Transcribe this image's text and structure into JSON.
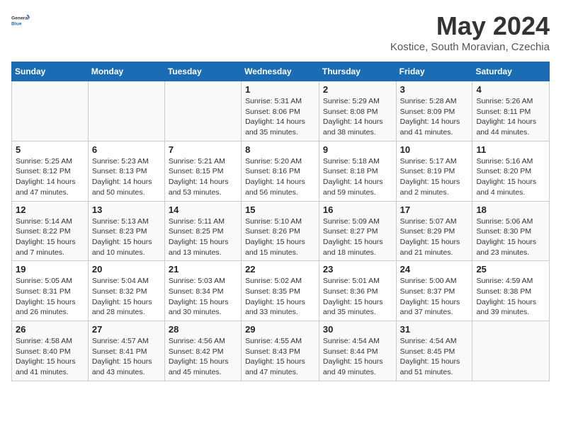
{
  "header": {
    "logo_line1": "General",
    "logo_line2": "Blue",
    "month_title": "May 2024",
    "location": "Kostice, South Moravian, Czechia"
  },
  "days_of_week": [
    "Sunday",
    "Monday",
    "Tuesday",
    "Wednesday",
    "Thursday",
    "Friday",
    "Saturday"
  ],
  "weeks": [
    [
      {
        "day": "",
        "sunrise": "",
        "sunset": "",
        "daylight": ""
      },
      {
        "day": "",
        "sunrise": "",
        "sunset": "",
        "daylight": ""
      },
      {
        "day": "",
        "sunrise": "",
        "sunset": "",
        "daylight": ""
      },
      {
        "day": "1",
        "sunrise": "Sunrise: 5:31 AM",
        "sunset": "Sunset: 8:06 PM",
        "daylight": "Daylight: 14 hours and 35 minutes."
      },
      {
        "day": "2",
        "sunrise": "Sunrise: 5:29 AM",
        "sunset": "Sunset: 8:08 PM",
        "daylight": "Daylight: 14 hours and 38 minutes."
      },
      {
        "day": "3",
        "sunrise": "Sunrise: 5:28 AM",
        "sunset": "Sunset: 8:09 PM",
        "daylight": "Daylight: 14 hours and 41 minutes."
      },
      {
        "day": "4",
        "sunrise": "Sunrise: 5:26 AM",
        "sunset": "Sunset: 8:11 PM",
        "daylight": "Daylight: 14 hours and 44 minutes."
      }
    ],
    [
      {
        "day": "5",
        "sunrise": "Sunrise: 5:25 AM",
        "sunset": "Sunset: 8:12 PM",
        "daylight": "Daylight: 14 hours and 47 minutes."
      },
      {
        "day": "6",
        "sunrise": "Sunrise: 5:23 AM",
        "sunset": "Sunset: 8:13 PM",
        "daylight": "Daylight: 14 hours and 50 minutes."
      },
      {
        "day": "7",
        "sunrise": "Sunrise: 5:21 AM",
        "sunset": "Sunset: 8:15 PM",
        "daylight": "Daylight: 14 hours and 53 minutes."
      },
      {
        "day": "8",
        "sunrise": "Sunrise: 5:20 AM",
        "sunset": "Sunset: 8:16 PM",
        "daylight": "Daylight: 14 hours and 56 minutes."
      },
      {
        "day": "9",
        "sunrise": "Sunrise: 5:18 AM",
        "sunset": "Sunset: 8:18 PM",
        "daylight": "Daylight: 14 hours and 59 minutes."
      },
      {
        "day": "10",
        "sunrise": "Sunrise: 5:17 AM",
        "sunset": "Sunset: 8:19 PM",
        "daylight": "Daylight: 15 hours and 2 minutes."
      },
      {
        "day": "11",
        "sunrise": "Sunrise: 5:16 AM",
        "sunset": "Sunset: 8:20 PM",
        "daylight": "Daylight: 15 hours and 4 minutes."
      }
    ],
    [
      {
        "day": "12",
        "sunrise": "Sunrise: 5:14 AM",
        "sunset": "Sunset: 8:22 PM",
        "daylight": "Daylight: 15 hours and 7 minutes."
      },
      {
        "day": "13",
        "sunrise": "Sunrise: 5:13 AM",
        "sunset": "Sunset: 8:23 PM",
        "daylight": "Daylight: 15 hours and 10 minutes."
      },
      {
        "day": "14",
        "sunrise": "Sunrise: 5:11 AM",
        "sunset": "Sunset: 8:25 PM",
        "daylight": "Daylight: 15 hours and 13 minutes."
      },
      {
        "day": "15",
        "sunrise": "Sunrise: 5:10 AM",
        "sunset": "Sunset: 8:26 PM",
        "daylight": "Daylight: 15 hours and 15 minutes."
      },
      {
        "day": "16",
        "sunrise": "Sunrise: 5:09 AM",
        "sunset": "Sunset: 8:27 PM",
        "daylight": "Daylight: 15 hours and 18 minutes."
      },
      {
        "day": "17",
        "sunrise": "Sunrise: 5:07 AM",
        "sunset": "Sunset: 8:29 PM",
        "daylight": "Daylight: 15 hours and 21 minutes."
      },
      {
        "day": "18",
        "sunrise": "Sunrise: 5:06 AM",
        "sunset": "Sunset: 8:30 PM",
        "daylight": "Daylight: 15 hours and 23 minutes."
      }
    ],
    [
      {
        "day": "19",
        "sunrise": "Sunrise: 5:05 AM",
        "sunset": "Sunset: 8:31 PM",
        "daylight": "Daylight: 15 hours and 26 minutes."
      },
      {
        "day": "20",
        "sunrise": "Sunrise: 5:04 AM",
        "sunset": "Sunset: 8:32 PM",
        "daylight": "Daylight: 15 hours and 28 minutes."
      },
      {
        "day": "21",
        "sunrise": "Sunrise: 5:03 AM",
        "sunset": "Sunset: 8:34 PM",
        "daylight": "Daylight: 15 hours and 30 minutes."
      },
      {
        "day": "22",
        "sunrise": "Sunrise: 5:02 AM",
        "sunset": "Sunset: 8:35 PM",
        "daylight": "Daylight: 15 hours and 33 minutes."
      },
      {
        "day": "23",
        "sunrise": "Sunrise: 5:01 AM",
        "sunset": "Sunset: 8:36 PM",
        "daylight": "Daylight: 15 hours and 35 minutes."
      },
      {
        "day": "24",
        "sunrise": "Sunrise: 5:00 AM",
        "sunset": "Sunset: 8:37 PM",
        "daylight": "Daylight: 15 hours and 37 minutes."
      },
      {
        "day": "25",
        "sunrise": "Sunrise: 4:59 AM",
        "sunset": "Sunset: 8:38 PM",
        "daylight": "Daylight: 15 hours and 39 minutes."
      }
    ],
    [
      {
        "day": "26",
        "sunrise": "Sunrise: 4:58 AM",
        "sunset": "Sunset: 8:40 PM",
        "daylight": "Daylight: 15 hours and 41 minutes."
      },
      {
        "day": "27",
        "sunrise": "Sunrise: 4:57 AM",
        "sunset": "Sunset: 8:41 PM",
        "daylight": "Daylight: 15 hours and 43 minutes."
      },
      {
        "day": "28",
        "sunrise": "Sunrise: 4:56 AM",
        "sunset": "Sunset: 8:42 PM",
        "daylight": "Daylight: 15 hours and 45 minutes."
      },
      {
        "day": "29",
        "sunrise": "Sunrise: 4:55 AM",
        "sunset": "Sunset: 8:43 PM",
        "daylight": "Daylight: 15 hours and 47 minutes."
      },
      {
        "day": "30",
        "sunrise": "Sunrise: 4:54 AM",
        "sunset": "Sunset: 8:44 PM",
        "daylight": "Daylight: 15 hours and 49 minutes."
      },
      {
        "day": "31",
        "sunrise": "Sunrise: 4:54 AM",
        "sunset": "Sunset: 8:45 PM",
        "daylight": "Daylight: 15 hours and 51 minutes."
      },
      {
        "day": "",
        "sunrise": "",
        "sunset": "",
        "daylight": ""
      }
    ]
  ]
}
